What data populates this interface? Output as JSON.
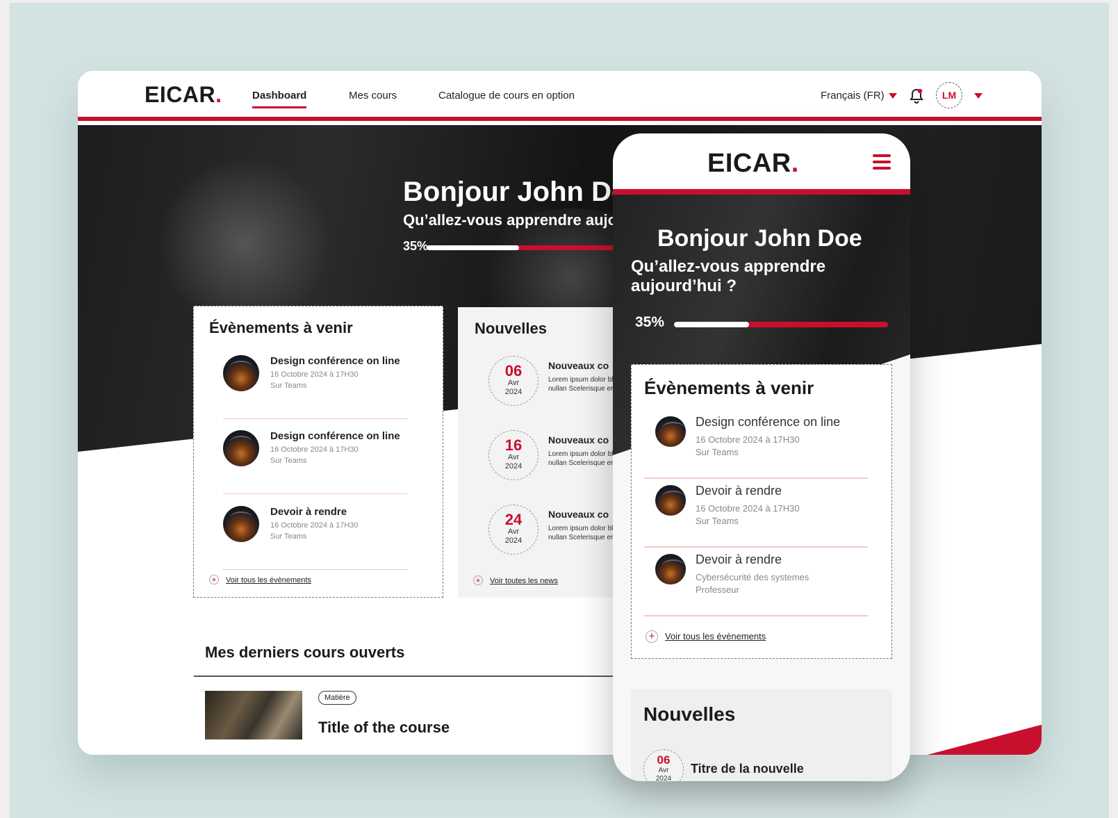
{
  "brand": {
    "name": "EICAR",
    "dot": ".",
    "accent": "#c8102e"
  },
  "nav": {
    "links": [
      "Dashboard",
      "Mes cours",
      "Catalogue de cours en option"
    ],
    "language": "Français (FR)",
    "user_initials": "LM"
  },
  "hero": {
    "greeting": "Bonjour John Doe",
    "question": "Qu’allez-vous apprendre aujourd’hui ?",
    "progress_label": "35%",
    "progress_value": 0.35
  },
  "events": {
    "title": "Évènements à venir",
    "items": [
      {
        "title": "Design conférence on line",
        "date": "16 Octobre 2024 à 17H30",
        "place": "Sur Teams"
      },
      {
        "title": "Design conférence on line",
        "date": "16 Octobre 2024 à 17H30",
        "place": "Sur Teams"
      },
      {
        "title": "Devoir à rendre",
        "date": "16 Octobre 2024 à 17H30",
        "place": "Sur Teams"
      }
    ],
    "see_all": "Voir tous les évènements"
  },
  "news": {
    "title": "Nouvelles",
    "items": [
      {
        "day": "06",
        "month": "Avr",
        "year": "2024",
        "title": "Nouveaux co",
        "body": "Lorem ipsum dolor blandit. Odio nullan Scelerisque erat to"
      },
      {
        "day": "16",
        "month": "Avr",
        "year": "2024",
        "title": "Nouveaux co",
        "body": "Lorem ipsum dolor blandit. Odio nullan Scelerisque erat to"
      },
      {
        "day": "24",
        "month": "Avr",
        "year": "2024",
        "title": "Nouveaux co",
        "body": "Lorem ipsum dolor blandit. Odio nullan Scelerisque erat to"
      }
    ],
    "see_all": "Voir toutes les news"
  },
  "recent": {
    "title": "Mes derniers cours ouverts",
    "badge": "Matière",
    "course_title": "Title of the course"
  },
  "mobile": {
    "greeting": "Bonjour John Doe",
    "question": "Qu’allez-vous apprendre aujourd’hui ?",
    "progress_label": "35%",
    "events_title": "Évènements à venir",
    "events": [
      {
        "title": "Design conférence on line",
        "line1": "16 Octobre 2024 à 17H30",
        "line2": "Sur Teams"
      },
      {
        "title": "Devoir à rendre",
        "line1": "16 Octobre 2024 à 17H30",
        "line2": "Sur Teams"
      },
      {
        "title": "Devoir à rendre",
        "line1": "Cybersécurité des systemes",
        "line2": "Professeur"
      }
    ],
    "see_all": "Voir tous les évènements",
    "news_title": "Nouvelles",
    "news_item": {
      "day": "06",
      "month": "Avr",
      "year": "2024",
      "title": "Titre de la nouvelle"
    }
  }
}
